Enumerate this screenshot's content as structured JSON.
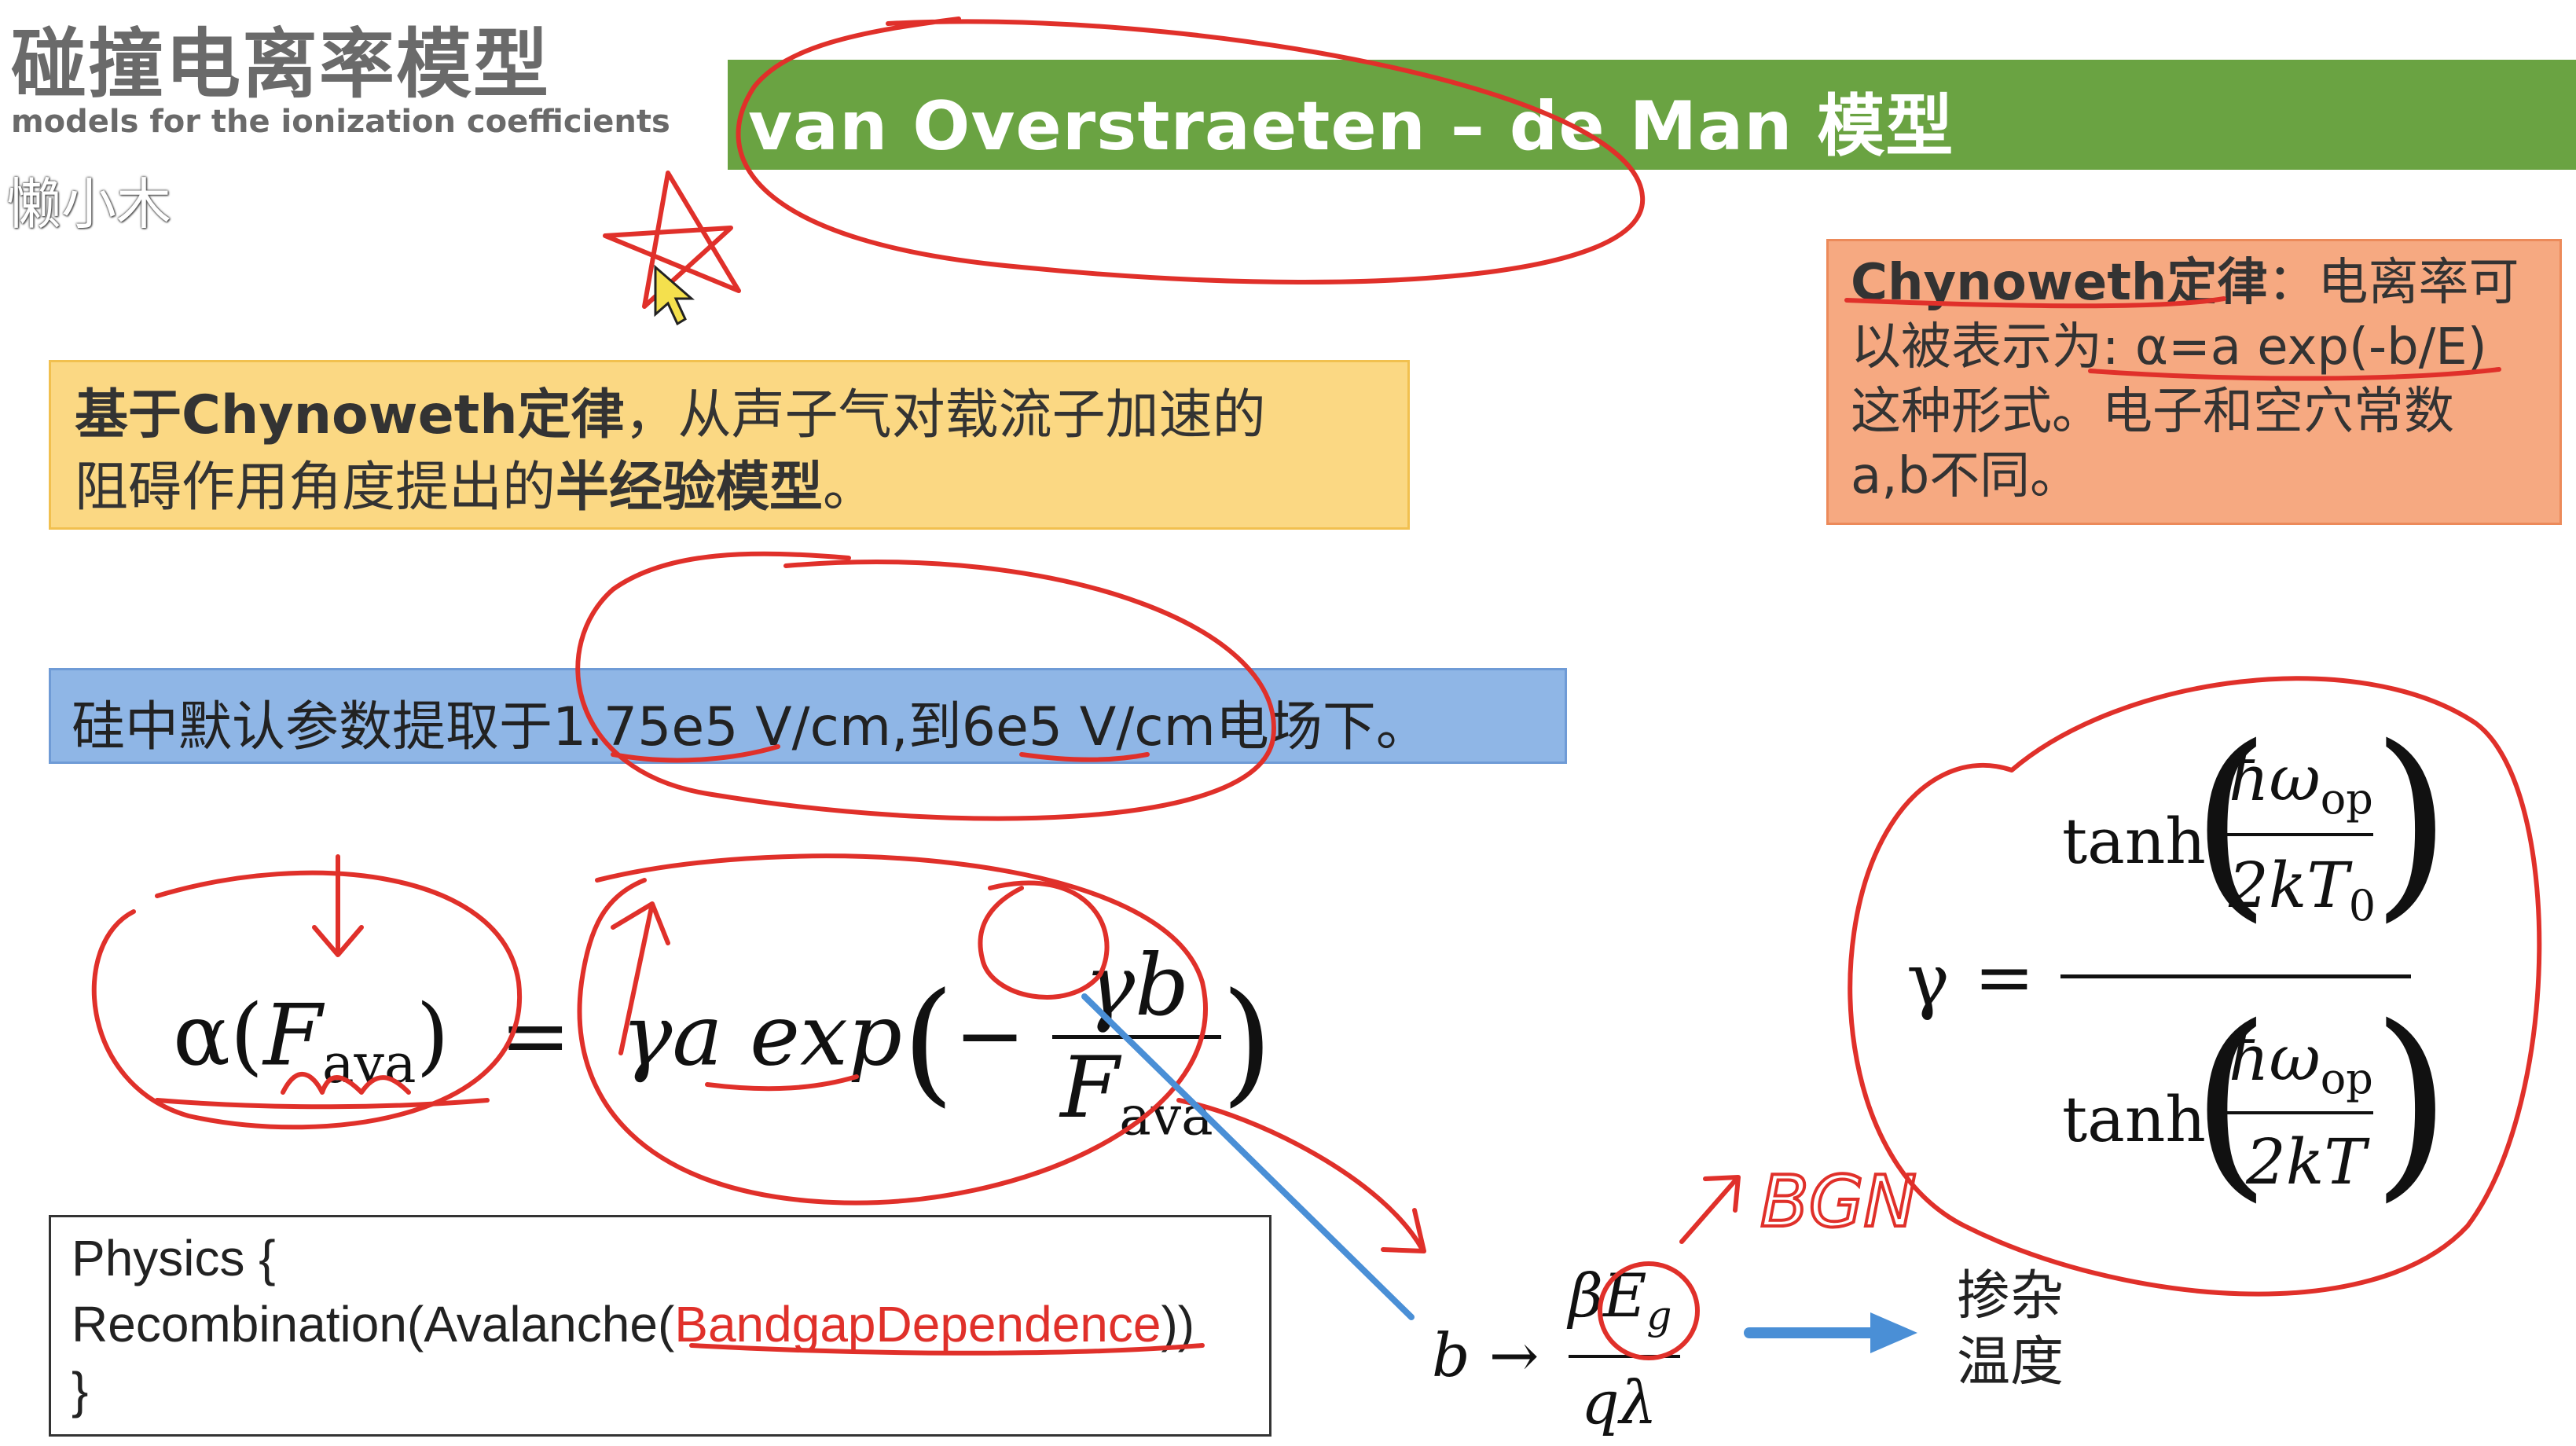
{
  "header": {
    "title_cn": "碰撞电离率模型",
    "title_en": "models for the ionization coefficients",
    "watermark": "懒小木"
  },
  "banner": {
    "text": "van Overstraeten – de Man 模型",
    "color": "#6aa342"
  },
  "yellow_box": {
    "line1_bold": "基于Chynoweth定律",
    "line1_rest": "，从声子气对载流子加速的",
    "line2_start": "阻碍作用角度提出的",
    "line2_bold": "半经验模型",
    "line2_end": "。"
  },
  "orange_box": {
    "line1_bold": "Chynoweth定律",
    "line1_rest": "：电离率可",
    "line2": "以被表示为: α=a exp(-b/E)",
    "line3": "这种形式。电子和空穴常数",
    "line4": "a,b不同。"
  },
  "blue_box": {
    "text": "硅中默认参数提取于1.75e5 V/cm,到6e5 V/cm电场下。"
  },
  "equation1": {
    "lhs_symbol": "α(",
    "lhs_var": "F",
    "lhs_sub": "ava",
    "lhs_close": ")",
    "equals": "=",
    "rhs_pre": "γa exp",
    "paren_open": "(",
    "minus": "−",
    "frac_num": "γb",
    "frac_den_var": "F",
    "frac_den_sub": "ava",
    "paren_close": ")"
  },
  "equation2": {
    "lhs": "γ",
    "equals": "=",
    "tanh": "tanh",
    "num_top": "ħω",
    "num_top_sub": "op",
    "num_bottom": "2kT",
    "num_bottom_sub": "0",
    "den_top": "ħω",
    "den_top_sub": "op",
    "den_bottom": "2kT"
  },
  "equation3": {
    "lhs": "b →",
    "num": "βE",
    "num_sub": "g",
    "den": "qλ"
  },
  "side_note": {
    "line1": "掺杂",
    "line2": "温度"
  },
  "handwritten": {
    "text": "BGN"
  },
  "code": {
    "line1": "Physics {",
    "line2_pre": "Recombination(Avalanche(",
    "line2_red": "BandgapDependence",
    "line2_post": "))",
    "line3": "}"
  },
  "colors": {
    "annotation_red": "#e0302a",
    "arrow_blue": "#4a8fd6"
  }
}
